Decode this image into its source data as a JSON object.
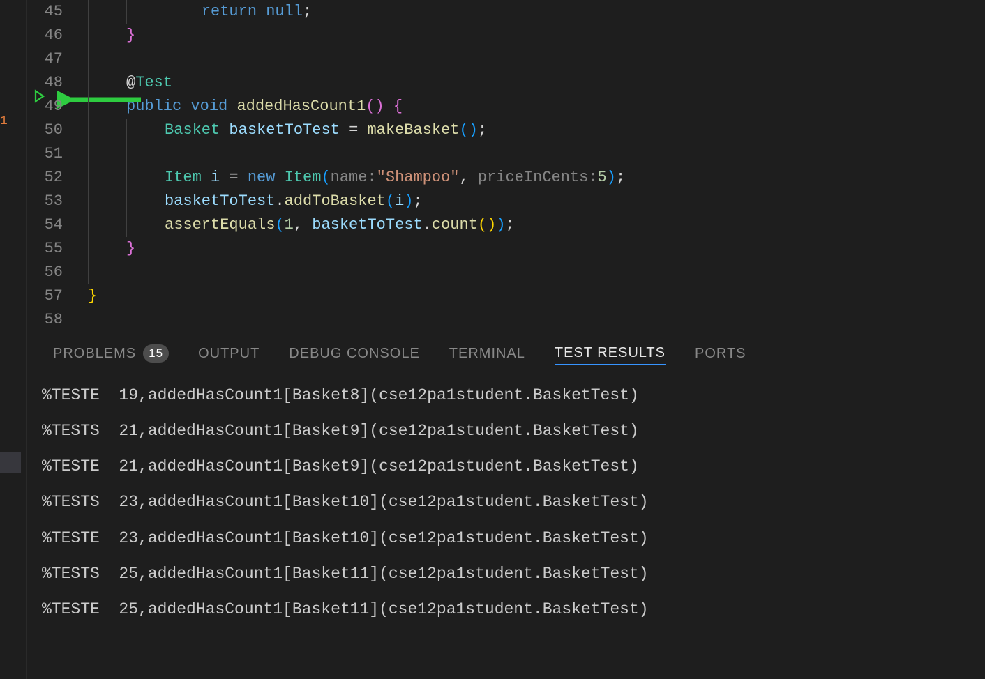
{
  "left_margin": {
    "indicator": "1"
  },
  "arrow_color": "#2ecc40",
  "code": {
    "line45": {
      "num": "45",
      "text_kw_return": "return",
      "text_kw_null": "null",
      "semi": ";"
    },
    "line46": {
      "num": "46",
      "brace": "}"
    },
    "line47": {
      "num": "47"
    },
    "line48": {
      "num": "48",
      "at": "@",
      "anno": "Test"
    },
    "line49": {
      "num": "49",
      "kw1": "public",
      "kw2": "void",
      "fn": "addedHasCount1",
      "paren": "()",
      "brace": "{"
    },
    "line50": {
      "num": "50",
      "type": "Basket",
      "var": "basketToTest",
      "eq": "=",
      "fn": "makeBasket",
      "paren": "()",
      "semi": ";"
    },
    "line51": {
      "num": "51"
    },
    "line52": {
      "num": "52",
      "type": "Item",
      "var": "i",
      "eq": "=",
      "kw": "new",
      "type2": "Item",
      "hint1": "name:",
      "str": "\"Shampoo\"",
      "comma": ",",
      "hint2": "priceInCents:",
      "num2": "5",
      "semi": ";"
    },
    "line53": {
      "num": "53",
      "var": "basketToTest",
      "dot": ".",
      "fn": "addToBasket",
      "arg": "i",
      "semi": ";"
    },
    "line54": {
      "num": "54",
      "fn": "assertEquals",
      "num1": "1",
      "comma": ",",
      "var": "basketToTest",
      "dot": ".",
      "fn2": "count",
      "paren": "()",
      "semi": ";"
    },
    "line55": {
      "num": "55",
      "brace": "}"
    },
    "line56": {
      "num": "56"
    },
    "line57": {
      "num": "57",
      "brace": "}"
    },
    "line58": {
      "num": "58"
    }
  },
  "panel": {
    "tabs": {
      "problems": "PROBLEMS",
      "problems_count": "15",
      "output": "OUTPUT",
      "debug": "DEBUG CONSOLE",
      "terminal": "TERMINAL",
      "testresults": "TEST RESULTS",
      "ports": "PORTS"
    },
    "results": [
      "%TESTE  19,addedHasCount1[Basket8](cse12pa1student.BasketTest)",
      "%TESTS  21,addedHasCount1[Basket9](cse12pa1student.BasketTest)",
      "%TESTE  21,addedHasCount1[Basket9](cse12pa1student.BasketTest)",
      "%TESTS  23,addedHasCount1[Basket10](cse12pa1student.BasketTest)",
      "%TESTE  23,addedHasCount1[Basket10](cse12pa1student.BasketTest)",
      "%TESTS  25,addedHasCount1[Basket11](cse12pa1student.BasketTest)",
      "%TESTE  25,addedHasCount1[Basket11](cse12pa1student.BasketTest)"
    ]
  }
}
